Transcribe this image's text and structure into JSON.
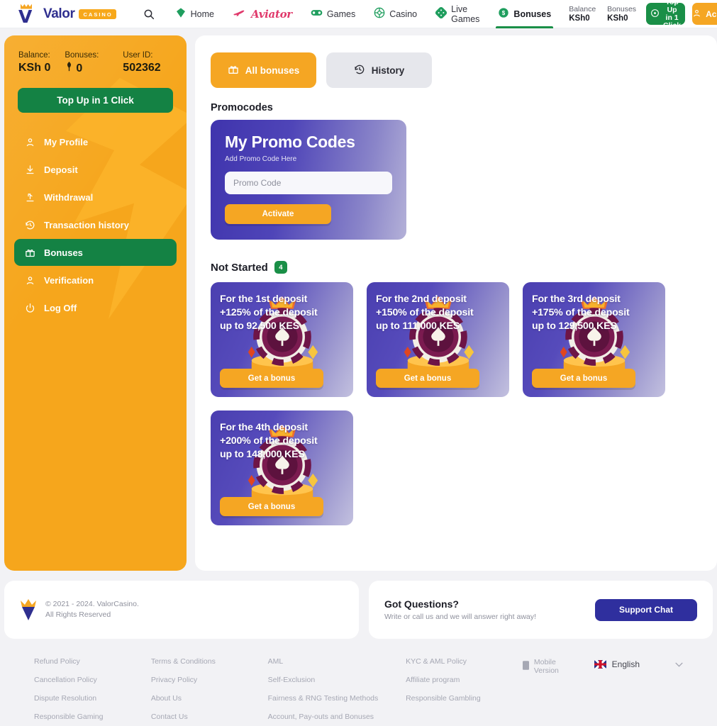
{
  "header": {
    "logo": {
      "name": "Valor",
      "badge": "CASINO"
    },
    "search_icon": "search-icon",
    "nav": [
      {
        "label": "Home",
        "icon": "diamond-icon",
        "active": false
      },
      {
        "label": "Aviator",
        "icon": "plane-icon",
        "active": false
      },
      {
        "label": "Games",
        "icon": "gamepad-icon",
        "active": false
      },
      {
        "label": "Casino",
        "icon": "roulette-icon",
        "active": false
      },
      {
        "label": "Live Games",
        "icon": "dice-icon",
        "active": false
      },
      {
        "label": "Bonuses",
        "icon": "dollar-coin-icon",
        "active": true
      }
    ],
    "balance": {
      "label": "Balance",
      "value": "KSh0"
    },
    "bonuses": {
      "label": "Bonuses",
      "value": "KSh0"
    },
    "topup_label": "Top Up in 1 Click",
    "account_label": "Account",
    "accent_green": "#1a8f47",
    "accent_orange": "#f5a623"
  },
  "sidebar": {
    "stats": [
      {
        "label": "Balance:",
        "value": "KSh 0"
      },
      {
        "label": "Bonuses:",
        "value": "0",
        "prefix_icon": "bonus-icon"
      },
      {
        "label": "User ID:",
        "value": "502362"
      }
    ],
    "topup_label": "Top Up in 1 Click",
    "items": [
      {
        "label": "My Profile",
        "icon": "user-icon",
        "active": false
      },
      {
        "label": "Deposit",
        "icon": "download-icon",
        "active": false
      },
      {
        "label": "Withdrawal",
        "icon": "upload-arrow-icon",
        "active": false
      },
      {
        "label": "Transaction history",
        "icon": "history-clock-icon",
        "active": false
      },
      {
        "label": "Bonuses",
        "icon": "gift-icon",
        "active": true
      },
      {
        "label": "Verification",
        "icon": "user-check-icon",
        "active": false
      },
      {
        "label": "Log Off",
        "icon": "power-icon",
        "active": false
      }
    ]
  },
  "main": {
    "tabs": [
      {
        "label": "All bonuses",
        "icon": "gift-icon",
        "active": true
      },
      {
        "label": "History",
        "icon": "history-clock-icon",
        "active": false
      }
    ],
    "promocodes_title": "Promocodes",
    "promo": {
      "title": "My Promo Codes",
      "subtitle": "Add Promo Code Here",
      "input_value": "",
      "input_placeholder": "Promo Code",
      "activate_label": "Activate"
    },
    "not_started": {
      "title": "Not Started",
      "count": "4"
    },
    "bonus_cards": [
      {
        "line1": "For the 1st deposit",
        "line2": "+125% of the deposit",
        "line3": "up to 92,500 KES",
        "cta": "Get a bonus"
      },
      {
        "line1": "For the 2nd deposit",
        "line2": "+150% of the deposit",
        "line3": "up to 111,000 KES",
        "cta": "Get a bonus"
      },
      {
        "line1": "For the 3rd deposit",
        "line2": "+175% of the deposit",
        "line3": "up to 129,500 KES",
        "cta": "Get a bonus"
      },
      {
        "line1": "For the 4th deposit",
        "line2": "+200% of the deposit",
        "line3": "up to 148,000 KES",
        "cta": "Get a bonus"
      }
    ]
  },
  "footer": {
    "copyright_line1": "© 2021 - 2024. ValorCasino.",
    "copyright_line2": "All Rights Reserved",
    "questions_title": "Got Questions?",
    "questions_sub": "Write or call us and we will answer right away!",
    "support_label": "Support Chat",
    "link_columns": [
      [
        "Refund Policy",
        "Cancellation Policy",
        "Dispute Resolution",
        "Responsible Gaming"
      ],
      [
        "Terms & Conditions",
        "Privacy Policy",
        "About Us",
        "Contact Us"
      ],
      [
        "AML",
        "Self-Exclusion",
        "Fairness & RNG Testing Methods",
        "Account, Pay-outs and Bonuses"
      ],
      [
        "KYC & AML Policy",
        "Affiliate program",
        "Responsible Gambling"
      ]
    ],
    "mobile_version": "Mobile Version",
    "language": "English"
  }
}
